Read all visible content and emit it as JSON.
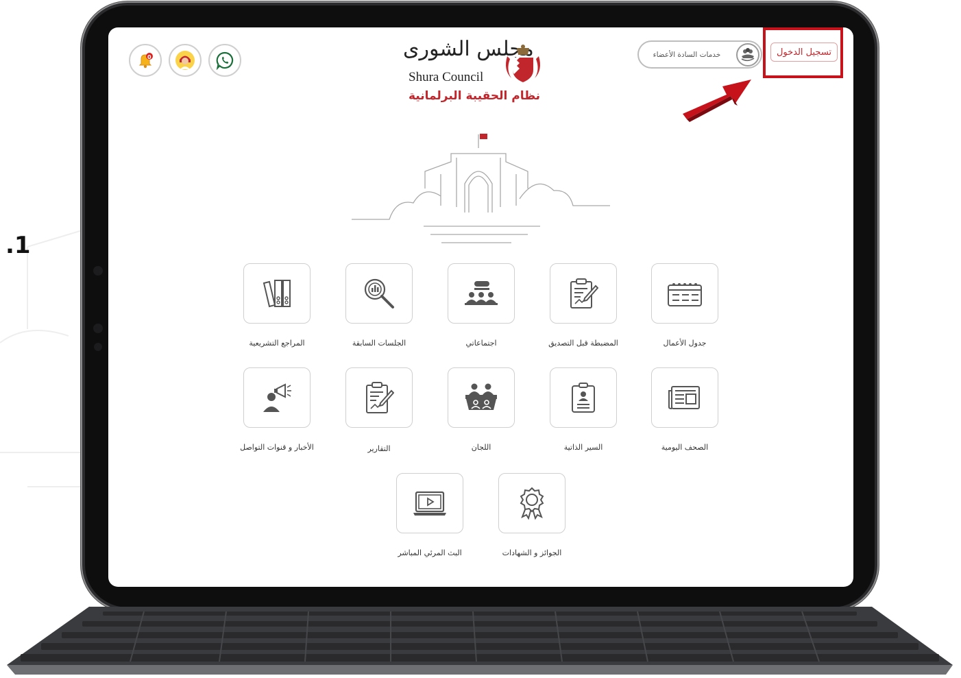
{
  "step_label": ".1",
  "header": {
    "login_label": "تسجيل الدخول",
    "members_services_label": "خدمات السادة الأعضاء",
    "notification_count": "0",
    "logo_arabic": "مجلس الشورى",
    "logo_english": "Shura Council",
    "system_title": "نظام الحقيبة البرلمانية"
  },
  "tiles": [
    {
      "label": "جدول الأعمال",
      "icon": "calendar-icon"
    },
    {
      "label": "المضبطة قبل التصديق",
      "icon": "document-edit-icon"
    },
    {
      "label": "اجتماعاتي",
      "icon": "meeting-icon"
    },
    {
      "label": "الجلسات السابقة",
      "icon": "search-chart-icon"
    },
    {
      "label": "المراجع التشريعية",
      "icon": "binders-icon"
    },
    {
      "label": "الصحف اليومية",
      "icon": "newspaper-icon"
    },
    {
      "label": "السير الذاتية",
      "icon": "id-badge-icon"
    },
    {
      "label": "اللجان",
      "icon": "committee-icon"
    },
    {
      "label": "التقارير",
      "icon": "report-icon"
    },
    {
      "label": "الأخبار و قنوات التواصل",
      "icon": "megaphone-icon"
    },
    {
      "label": "الجوائز و الشهادات",
      "icon": "award-icon"
    },
    {
      "label": "البث المرئي المباشر",
      "icon": "video-icon"
    }
  ],
  "colors": {
    "brand_red": "#c0262b",
    "highlight_red": "#c6131b"
  }
}
